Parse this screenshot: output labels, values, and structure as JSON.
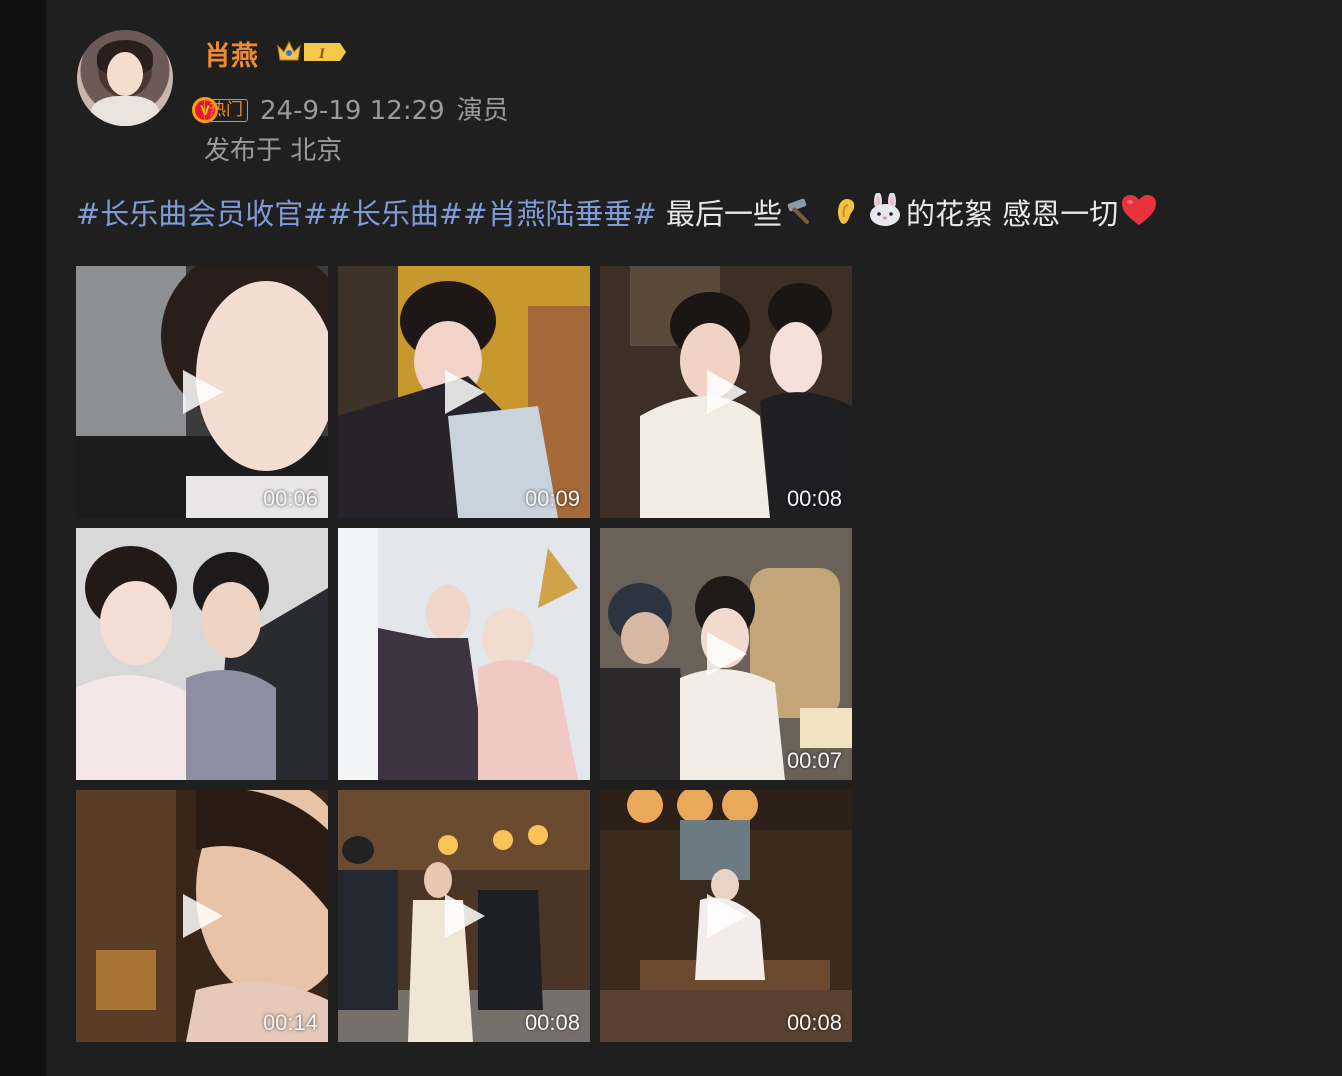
{
  "post": {
    "username": "肖燕",
    "vip_level": "I",
    "hot_tag": "热门",
    "timestamp": "24-9-19 12:29",
    "source": "演员",
    "location": "发布于 北京",
    "hashtags": "#长乐曲会员收官##长乐曲##肖燕陆垂垂#",
    "text_part1": " 最后一些",
    "text_part2": "的花絮 感恩一切",
    "emojis": [
      "hammer-emoji",
      "ear-emoji",
      "rabbit-emoji",
      "red-heart-emoji"
    ],
    "colors": {
      "username": "#f08a32",
      "hashtag": "#7f9bd6",
      "meta": "#9a9a9a",
      "heart": "#e8323c"
    }
  },
  "media": [
    {
      "type": "video",
      "duration": "00:06"
    },
    {
      "type": "video",
      "duration": "00:09"
    },
    {
      "type": "video",
      "duration": "00:08"
    },
    {
      "type": "image",
      "duration": ""
    },
    {
      "type": "image",
      "duration": ""
    },
    {
      "type": "video",
      "duration": "00:07"
    },
    {
      "type": "video",
      "duration": "00:14"
    },
    {
      "type": "video",
      "duration": "00:08"
    },
    {
      "type": "video",
      "duration": "00:08"
    }
  ]
}
